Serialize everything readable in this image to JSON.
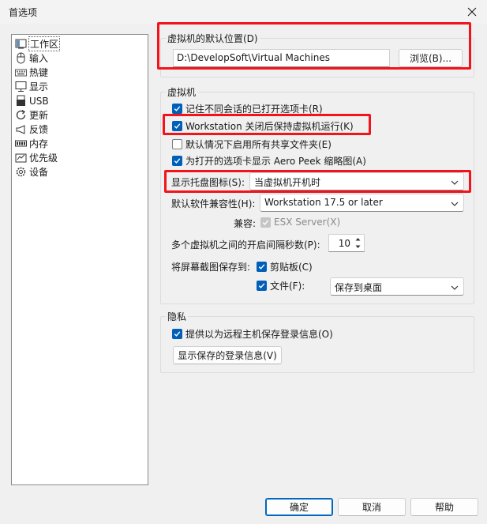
{
  "window": {
    "title": "首选项",
    "close_icon": "close-icon"
  },
  "nav": {
    "items": [
      {
        "label": "工作区",
        "icon": "workspace-icon",
        "selected": true
      },
      {
        "label": "输入",
        "icon": "mouse-icon"
      },
      {
        "label": "热键",
        "icon": "keyboard-icon"
      },
      {
        "label": "显示",
        "icon": "monitor-icon"
      },
      {
        "label": "USB",
        "icon": "usb-icon"
      },
      {
        "label": "更新",
        "icon": "refresh-icon"
      },
      {
        "label": "反馈",
        "icon": "megaphone-icon"
      },
      {
        "label": "内存",
        "icon": "memory-icon"
      },
      {
        "label": "优先级",
        "icon": "priority-icon"
      },
      {
        "label": "设备",
        "icon": "device-gear-icon"
      }
    ]
  },
  "default_location": {
    "group_title": "虚拟机的默认位置(D)",
    "path": "D:\\DevelopSoft\\Virtual Machines",
    "browse_label": "浏览(B)..."
  },
  "vm": {
    "group_title": "虚拟机",
    "remember_tabs": {
      "label": "记住不同会话的已打开选项卡(R)",
      "checked": true
    },
    "keep_running": {
      "label": "Workstation 关闭后保持虚拟机运行(K)",
      "checked": true
    },
    "enable_shared": {
      "label": "默认情况下启用所有共享文件夹(E)",
      "checked": false
    },
    "aero_peek": {
      "label": "为打开的选项卡显示 Aero Peek 缩略图(A)",
      "checked": true
    },
    "tray_icon": {
      "label": "显示托盘图标(S):",
      "value": "当虚拟机开机时"
    },
    "compat": {
      "label": "默认软件兼容性(H):",
      "value": "Workstation 17.5 or later"
    },
    "compat_with": {
      "label": "兼容:",
      "option": "ESX Server(X)",
      "checked": true,
      "disabled": true
    },
    "interval": {
      "label": "多个虚拟机之间的开启间隔秒数(P):",
      "value": "10"
    },
    "screenshot": {
      "label": "将屏幕截图保存到:",
      "clipboard": {
        "label": "剪贴板(C)",
        "checked": true
      },
      "file": {
        "label": "文件(F):",
        "checked": true,
        "value": "保存到桌面"
      }
    }
  },
  "privacy": {
    "group_title": "隐私",
    "save_login": {
      "label": "提供以为远程主机保存登录信息(O)",
      "checked": true
    },
    "show_saved_label": "显示保存的登录信息(V)"
  },
  "footer": {
    "ok_label": "确定",
    "cancel_label": "取消",
    "help_label": "帮助"
  },
  "colors": {
    "accent": "#005fb8",
    "highlight": "#f2131b",
    "background": "#f0f0f0"
  }
}
